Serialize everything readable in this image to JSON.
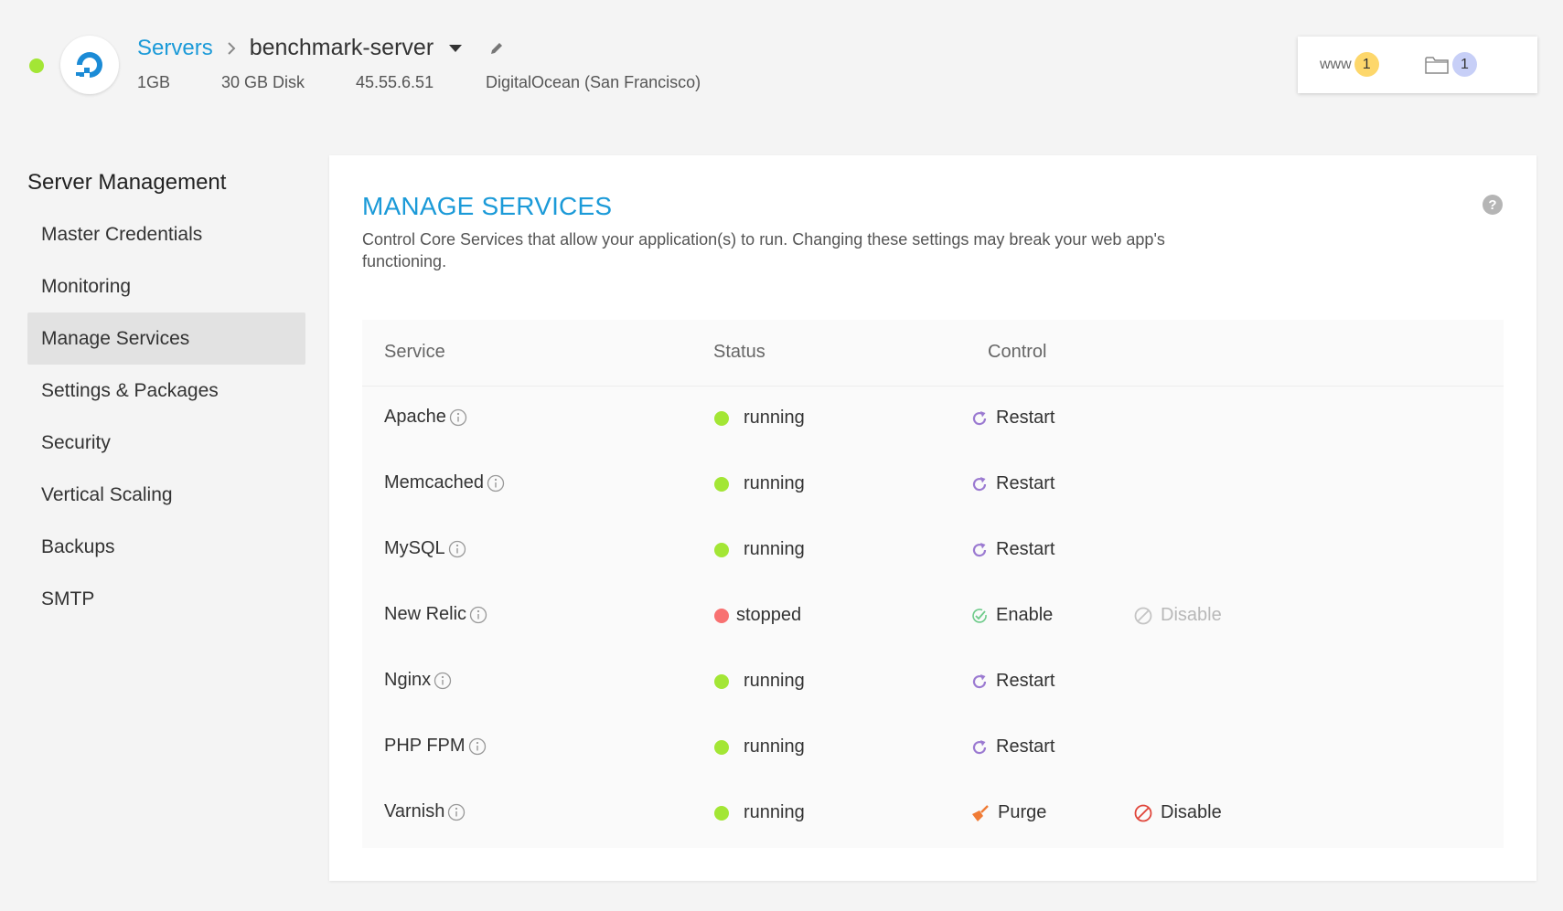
{
  "header": {
    "breadcrumb_link": "Servers",
    "server_name": "benchmark-server",
    "meta": {
      "size": "1GB",
      "disk": "30 GB Disk",
      "ip": "45.55.6.51",
      "provider": "DigitalOcean (San Francisco)"
    },
    "status_color": "#a3e635"
  },
  "counts": {
    "www_label": "www",
    "www_count": "1",
    "folder_count": "1"
  },
  "sidebar": {
    "title": "Server Management",
    "items": [
      {
        "label": "Master Credentials"
      },
      {
        "label": "Monitoring"
      },
      {
        "label": "Manage Services",
        "active": true
      },
      {
        "label": "Settings & Packages"
      },
      {
        "label": "Security"
      },
      {
        "label": "Vertical Scaling"
      },
      {
        "label": "Backups"
      },
      {
        "label": "SMTP"
      }
    ]
  },
  "main": {
    "title": "MANAGE SERVICES",
    "help": "?",
    "description": "Control Core Services that allow your application(s) to run. Changing these settings may break your web app's functioning.",
    "columns": {
      "service": "Service",
      "status": "Status",
      "control": "Control"
    },
    "services": [
      {
        "name": "Apache",
        "status": "running",
        "action1": "Restart",
        "action1_icon": "restart-icon"
      },
      {
        "name": "Memcached",
        "status": "running",
        "action1": "Restart",
        "action1_icon": "restart-icon"
      },
      {
        "name": "MySQL",
        "status": "running",
        "action1": "Restart",
        "action1_icon": "restart-icon"
      },
      {
        "name": "New Relic",
        "status": "stopped",
        "action1": "Enable",
        "action1_icon": "enable-icon",
        "action2": "Disable",
        "action2_disabled": true
      },
      {
        "name": "Nginx",
        "status": "running",
        "action1": "Restart",
        "action1_icon": "restart-icon"
      },
      {
        "name": "PHP FPM",
        "status": "running",
        "action1": "Restart",
        "action1_icon": "restart-icon"
      },
      {
        "name": "Varnish",
        "status": "running",
        "action1": "Purge",
        "action1_icon": "purge-icon",
        "action2": "Disable",
        "action2_disabled": false
      }
    ]
  },
  "colors": {
    "accent": "#1b9ad8",
    "running": "#a3e635",
    "stopped": "#f87171",
    "restart_icon": "#9b7ad1",
    "enable_icon": "#6ecb8a",
    "disable_icon": "#e0453a",
    "purge_icon": "#f07b35"
  }
}
